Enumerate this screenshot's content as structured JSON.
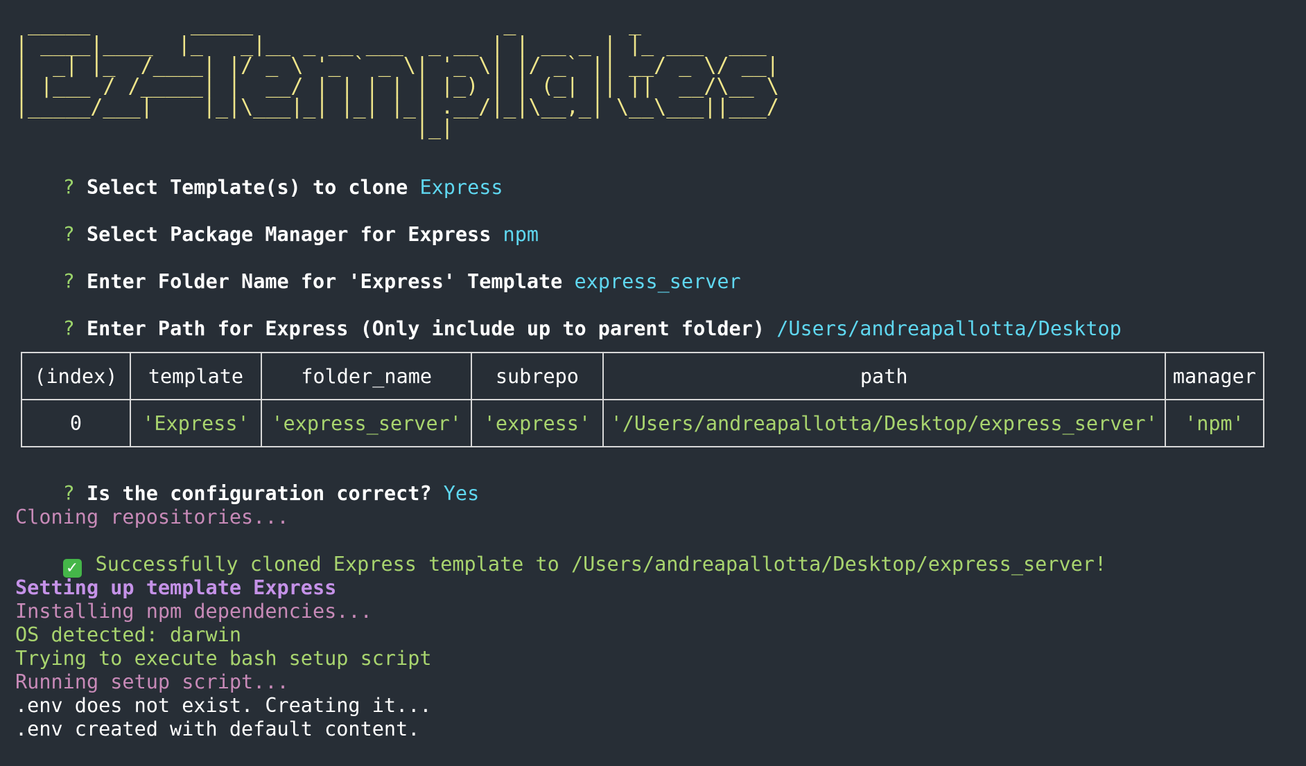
{
  "banner": " _____        _____                    _         _\n| ____|____  |_   _|__ _ __ ___  _ __ | | __ _ | |_ ___  ___\n|  _| |_  /____| |/ _ \\ '_ ` _ \\| '_ \\| |/ _` || __/ _ \\/ __|\n| |___ / /_____| |  __/ | | | | | |_) | | (_| || ||  __/\\__ \\\n|_____/___|    |_|\\___|_| |_| |_| .__/|_|\\__,_| \\__\\___||___/\n                                |_|",
  "prompts": [
    {
      "marker": "?",
      "question": "Select Template(s) to clone",
      "answer": "Express"
    },
    {
      "marker": "?",
      "question": "Select Package Manager for Express",
      "answer": "npm"
    },
    {
      "marker": "?",
      "question": "Enter Folder Name for 'Express' Template",
      "answer": "express_server"
    },
    {
      "marker": "?",
      "question": "Enter Path for Express (Only include up to parent folder)",
      "answer": "/Users/andreapallotta/Desktop"
    }
  ],
  "table": {
    "headers": [
      "(index)",
      "template",
      "folder_name",
      "subrepo",
      "path",
      "manager"
    ],
    "rows": [
      [
        "0",
        "'Express'",
        "'express_server'",
        "'express'",
        "'/Users/andreapallotta/Desktop/express_server'",
        "'npm'"
      ]
    ]
  },
  "confirm": {
    "marker": "?",
    "question": "Is the configuration correct?",
    "answer": "Yes"
  },
  "log": {
    "cloning": "Cloning repositories...",
    "check_icon": "✓",
    "success": "Successfully cloned Express template to /Users/andreapallotta/Desktop/express_server!",
    "setup_heading": "Setting up template Express",
    "installing": "Installing npm dependencies...",
    "os_detected": "OS detected: darwin",
    "trying": "Trying to execute bash setup script",
    "running": "Running setup script...",
    "env_missing": ".env does not exist. Creating it...",
    "env_created": ".env created with default content."
  },
  "colors": {
    "background": "#272e36",
    "banner": "#efe58a",
    "answer": "#5fd7f0",
    "success": "#a8d46e",
    "info": "#c88ab8",
    "heading": "#c592e8"
  }
}
